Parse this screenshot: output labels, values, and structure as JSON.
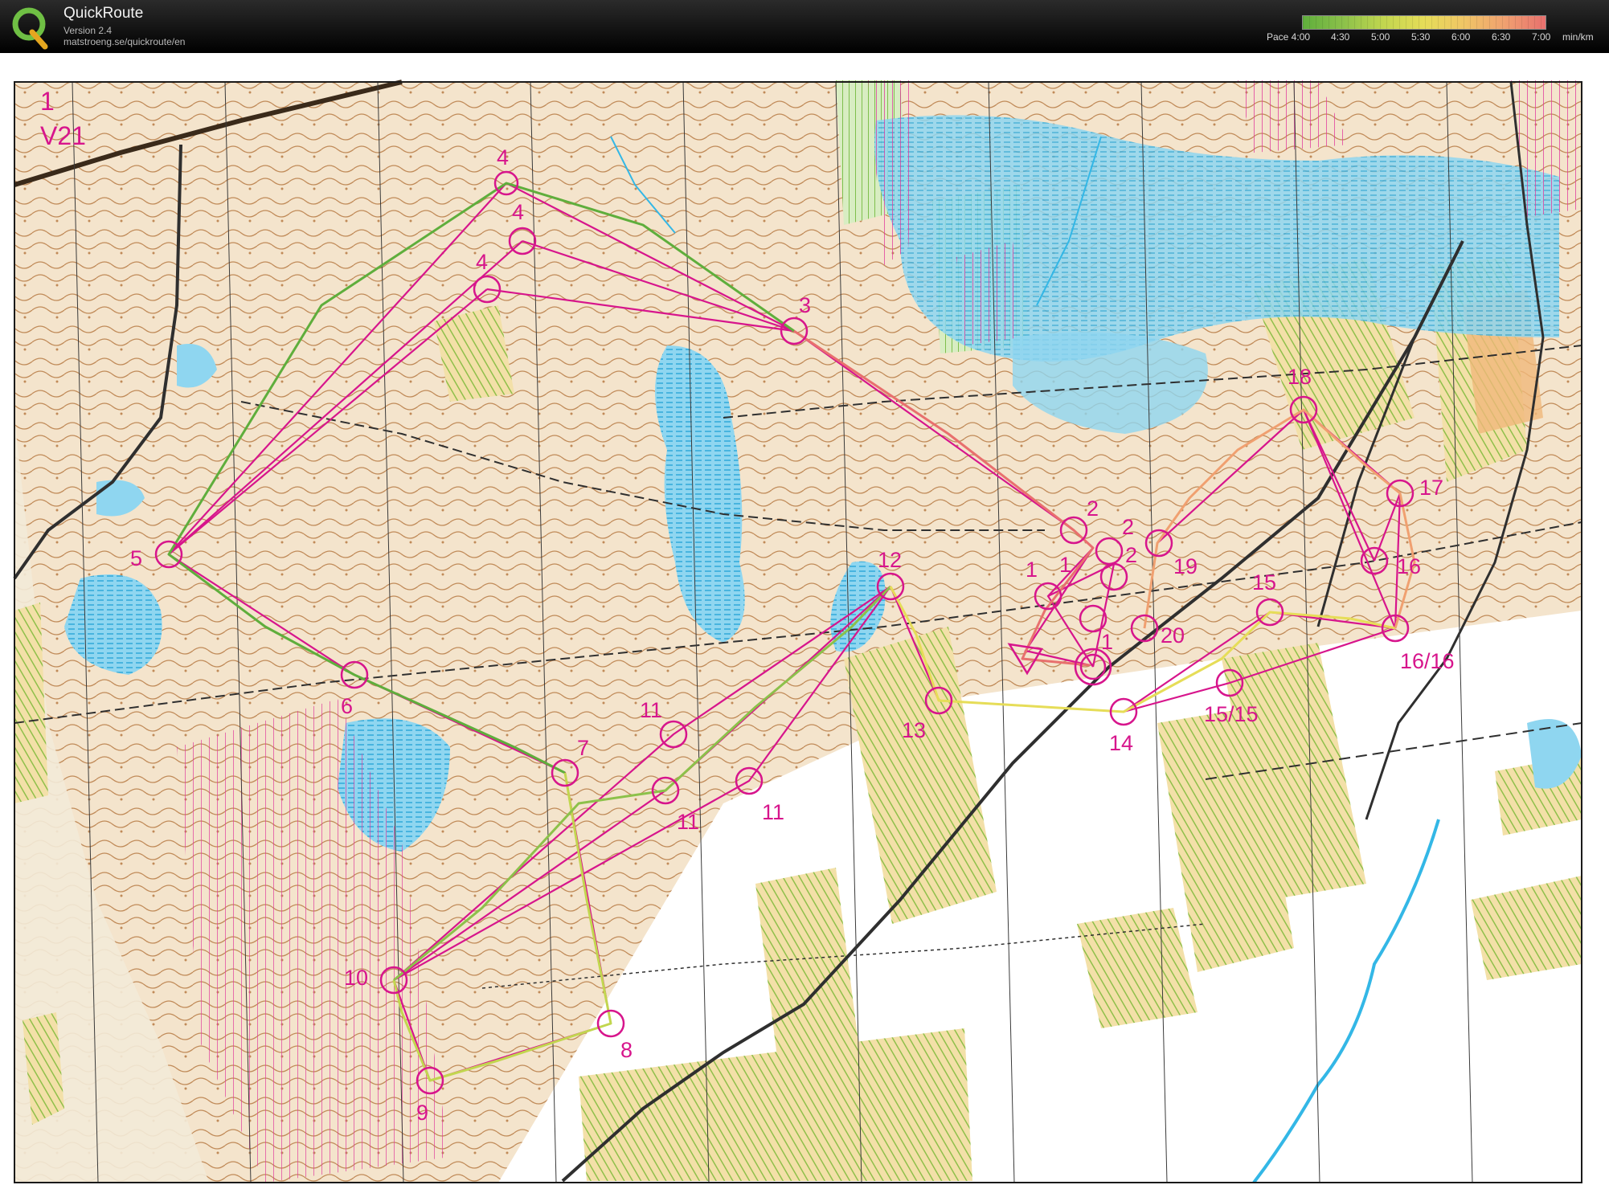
{
  "app": {
    "title": "QuickRoute",
    "version": "Version 2.4",
    "url": "matstroeng.se/quickroute/en"
  },
  "pace_scale": {
    "labels": [
      "Pace 4:00",
      "4:30",
      "5:00",
      "5:30",
      "6:00",
      "6:30",
      "7:00"
    ],
    "unit": "min/km",
    "colors": [
      "#5fae3c",
      "#8cc14a",
      "#c2d64f",
      "#e6dd58",
      "#f0c566",
      "#f0a070",
      "#e8706e"
    ]
  },
  "map": {
    "course_number": "1",
    "class_name": "V21",
    "control_labels": [
      "4",
      "4",
      "4",
      "3",
      "5",
      "6",
      "7",
      "8",
      "9",
      "10",
      "11",
      "11",
      "11",
      "12",
      "13",
      "14",
      "2",
      "2",
      "2",
      "1",
      "1",
      "1",
      "19",
      "20",
      "18",
      "17",
      "16",
      "16/16",
      "15",
      "15/15"
    ],
    "colors": {
      "course": "#d7158c",
      "contour": "#b5794a",
      "water": "#33b7e6",
      "open_land": "#f5d9a1",
      "forest": "#ffffff",
      "track": "#2f2f2f",
      "meridian": "#3a3a3a",
      "green_vegetation": "#9ccf6a"
    },
    "route_colors": [
      "#5fae3c",
      "#c2d64f",
      "#e6dd58",
      "#e8706e"
    ]
  }
}
